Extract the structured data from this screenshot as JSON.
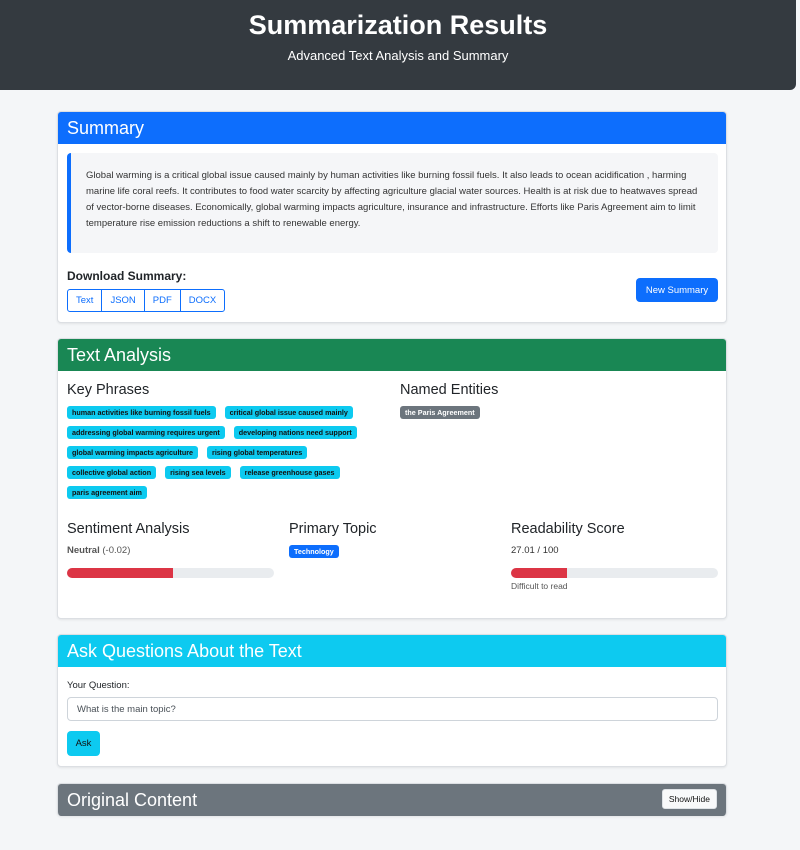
{
  "header": {
    "title": "Summarization Results",
    "subtitle": "Advanced Text Analysis and Summary"
  },
  "summary_card": {
    "title": "Summary",
    "text": "Global warming is a critical global issue caused mainly by human activities like burning fossil fuels. It also leads to ocean acidification , harming marine life coral reefs. It contributes to food water scarcity by affecting agriculture glacial water sources. Health is at risk due to heatwaves spread of vector-borne diseases. Economically, global warming impacts agriculture, insurance and infrastructure. Efforts like Paris Agreement aim to limit temperature rise emission reductions a shift to renewable energy.",
    "download_label": "Download Summary:",
    "download_buttons": [
      "Text",
      "JSON",
      "PDF",
      "DOCX"
    ],
    "new_summary_label": "New Summary"
  },
  "analysis_card": {
    "title": "Text Analysis",
    "key_phrases_title": "Key Phrases",
    "key_phrases": [
      "human activities like burning fossil fuels",
      "critical global issue caused mainly",
      "addressing global warming requires urgent",
      "developing nations need support",
      "global warming impacts agriculture",
      "rising global temperatures",
      "collective global action",
      "rising sea levels",
      "release greenhouse gases",
      "paris agreement aim"
    ],
    "named_entities_title": "Named Entities",
    "named_entities": [
      "the Paris Agreement"
    ],
    "sentiment_title": "Sentiment Analysis",
    "sentiment_label": "Neutral",
    "sentiment_score": "(-0.02)",
    "sentiment_bar_percent": 51,
    "topic_title": "Primary Topic",
    "topic": "Technology",
    "readability_title": "Readability Score",
    "readability_score": "27.01 / 100",
    "readability_bar_percent": 27,
    "readability_note": "Difficult to read"
  },
  "questions_card": {
    "title": "Ask Questions About the Text",
    "question_label": "Your Question:",
    "question_value": "What is the main topic?",
    "ask_label": "Ask"
  },
  "original_card": {
    "title": "Original Content",
    "toggle_label": "Show/Hide"
  },
  "colors": {
    "summary_header": "#0d6efd",
    "analysis_header": "#198754",
    "questions_header": "#0dcaf0",
    "original_header": "#6c757d",
    "progress_fill": "#dc3545"
  }
}
